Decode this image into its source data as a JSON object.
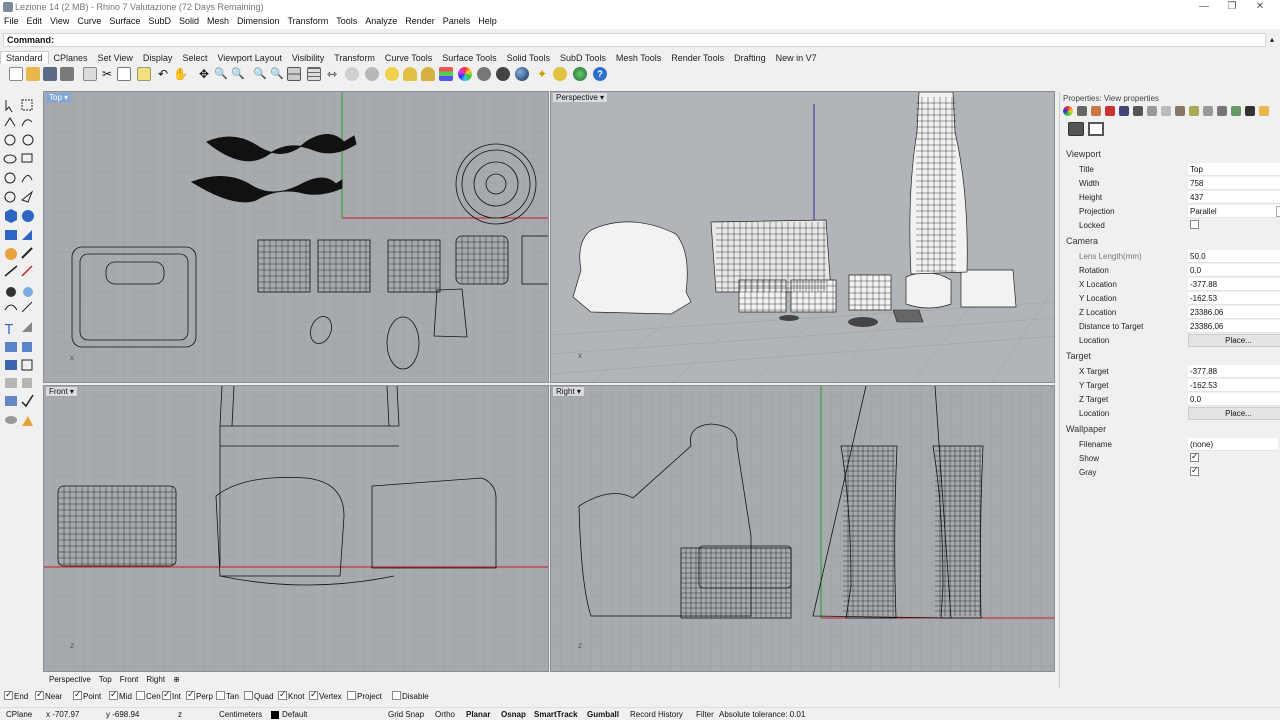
{
  "window": {
    "title": "Lezione 14 (2 MB) - Rhino 7 Valutazione (72 Days Remaining)",
    "minimize": "—",
    "restore": "❐",
    "close": "✕"
  },
  "menu": [
    "File",
    "Edit",
    "View",
    "Curve",
    "Surface",
    "SubD",
    "Solid",
    "Mesh",
    "Dimension",
    "Transform",
    "Tools",
    "Analyze",
    "Render",
    "Panels",
    "Help"
  ],
  "command": {
    "label": "Command:",
    "value": ""
  },
  "toolbar_tabs": [
    "Standard",
    "CPlanes",
    "Set View",
    "Display",
    "Select",
    "Viewport Layout",
    "Visibility",
    "Transform",
    "Curve Tools",
    "Surface Tools",
    "Solid Tools",
    "SubD Tools",
    "Mesh Tools",
    "Render Tools",
    "Drafting",
    "New in V7"
  ],
  "toolbar_icons": [
    "new-icon",
    "open-icon",
    "save-icon",
    "print-icon",
    "import-icon",
    "cut-icon",
    "copy-icon",
    "paste-icon",
    "undo-icon",
    "pan-icon",
    "rotate-view-icon",
    "zoom-icon",
    "zoom-window-icon",
    "zoom-extents-icon",
    "zoom-selected-icon",
    "four-view-icon",
    "grid-icon",
    "move-icon",
    "copy-object-icon",
    "hide-icon",
    "show-icon",
    "lock-icon",
    "unlock-icon",
    "layer-icon",
    "material-icon",
    "wireframe-icon",
    "shaded-icon",
    "rendered-icon",
    "render-icon",
    "light-icon",
    "analyze-icon",
    "help-icon"
  ],
  "viewports": {
    "top": {
      "label": "Top ▾"
    },
    "perspective": {
      "label": "Perspective ▾"
    },
    "front": {
      "label": "Front ▾"
    },
    "right": {
      "label": "Right ▾"
    }
  },
  "viewport_tabs": [
    "Perspective",
    "Top",
    "Front",
    "Right",
    "⊕"
  ],
  "osnaps": [
    {
      "label": "End",
      "on": true
    },
    {
      "label": "Near",
      "on": true
    },
    {
      "label": "Point",
      "on": true
    },
    {
      "label": "Mid",
      "on": true
    },
    {
      "label": "Cen",
      "on": false
    },
    {
      "label": "Int",
      "on": true
    },
    {
      "label": "Perp",
      "on": true
    },
    {
      "label": "Tan",
      "on": false
    },
    {
      "label": "Quad",
      "on": false
    },
    {
      "label": "Knot",
      "on": true
    },
    {
      "label": "Vertex",
      "on": true
    },
    {
      "label": "Project",
      "on": false
    },
    {
      "label": "Disable",
      "on": false
    }
  ],
  "status": {
    "cplane": "CPlane",
    "x": "x -707.97",
    "y": "y -698.94",
    "z": "z",
    "units": "Centimeters",
    "layer": "Default",
    "grid_snap": "Grid Snap",
    "ortho": "Ortho",
    "planar": "Planar",
    "osnap": "Osnap",
    "smarttrack": "SmartTrack",
    "gumball": "Gumball",
    "record_history": "Record History",
    "filter": "Filter",
    "tolerance": "Absolute tolerance: 0.01"
  },
  "panel": {
    "header": "Properties: View properties",
    "sections": {
      "viewport": "Viewport",
      "camera": "Camera",
      "target": "Target",
      "wallpaper": "Wallpaper"
    },
    "viewport": {
      "title_k": "Title",
      "title_v": "Top",
      "width_k": "Width",
      "width_v": "758",
      "height_k": "Height",
      "height_v": "437",
      "projection_k": "Projection",
      "projection_v": "Parallel",
      "locked_k": "Locked"
    },
    "camera": {
      "lens_k": "Lens Length(mm)",
      "lens_v": "50.0",
      "rotation_k": "Rotation",
      "rotation_v": "0.0",
      "xloc_k": "X Location",
      "xloc_v": "-377.88",
      "yloc_k": "Y Location",
      "yloc_v": "-162.53",
      "zloc_k": "Z Location",
      "zloc_v": "23386.06",
      "dist_k": "Distance to Target",
      "dist_v": "23386.06",
      "location_k": "Location",
      "place": "Place..."
    },
    "target": {
      "xt_k": "X Target",
      "xt_v": "-377.88",
      "yt_k": "Y Target",
      "yt_v": "-162.53",
      "zt_k": "Z Target",
      "zt_v": "0.0",
      "location_k": "Location",
      "place": "Place..."
    },
    "wallpaper": {
      "filename_k": "Filename",
      "filename_v": "(none)",
      "browse": "...",
      "show_k": "Show",
      "gray_k": "Gray"
    }
  }
}
